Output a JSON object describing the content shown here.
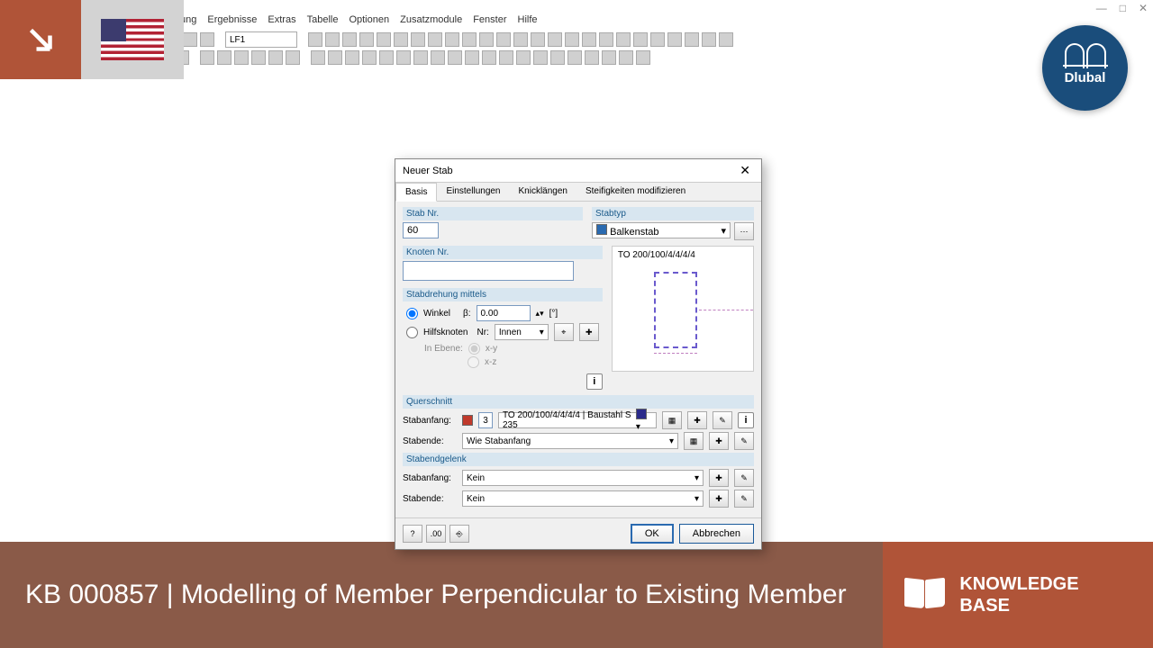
{
  "menubar": [
    "ung",
    "Ergebnisse",
    "Extras",
    "Tabelle",
    "Optionen",
    "Zusatzmodule",
    "Fenster",
    "Hilfe"
  ],
  "lf_selector": "LF1",
  "dialog": {
    "title": "Neuer Stab",
    "tabs": [
      "Basis",
      "Einstellungen",
      "Knicklängen",
      "Steifigkeiten modifizieren"
    ],
    "stab_nr_label": "Stab Nr.",
    "stab_nr_value": "60",
    "stabtyp_label": "Stabtyp",
    "stabtyp_value": "Balkenstab",
    "knoten_label": "Knoten Nr.",
    "knoten_value": "",
    "preview_label": "TO 200/100/4/4/4/4",
    "rotation_label": "Stabdrehung mittels",
    "rotation_opt1": "Winkel",
    "rotation_beta": "β:",
    "rotation_value": "0.00",
    "rotation_unit": "[°]",
    "rotation_opt2": "Hilfsknoten",
    "rotation_nr": "Nr:",
    "rotation_innen": "Innen",
    "rotation_plane_label": "In Ebene:",
    "rotation_plane_xy": "x-y",
    "rotation_plane_xz": "x-z",
    "querschnitt_label": "Querschnitt",
    "stabanfang_label": "Stabanfang:",
    "stabanfang_num": "3",
    "stabanfang_section": "TO 200/100/4/4/4/4",
    "stabanfang_material": "Baustahl S 235",
    "stabende_label": "Stabende:",
    "stabende_value": "Wie Stabanfang",
    "gelenk_label": "Stabendgelenk",
    "gelenk_anfang_label": "Stabanfang:",
    "gelenk_anfang_value": "Kein",
    "gelenk_ende_label": "Stabende:",
    "gelenk_ende_value": "Kein",
    "ok": "OK",
    "cancel": "Abbrechen"
  },
  "logo": "Dlubal",
  "banner": {
    "title": "KB 000857 | Modelling of Member Perpendicular to Existing Member",
    "category": "KNOWLEDGE BASE"
  }
}
